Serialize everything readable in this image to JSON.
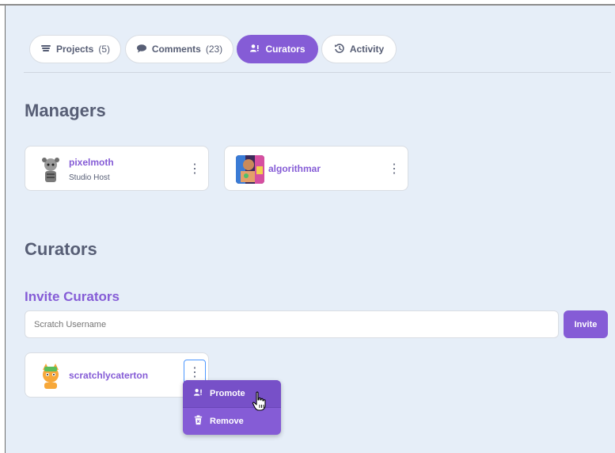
{
  "tabs": [
    {
      "label": "Projects",
      "count": "(5)",
      "icon": "projects-icon"
    },
    {
      "label": "Comments",
      "count": "(23)",
      "icon": "comment-icon"
    },
    {
      "label": "Curators",
      "count": "",
      "icon": "curators-icon",
      "active": true
    },
    {
      "label": "Activity",
      "count": "",
      "icon": "history-icon"
    }
  ],
  "managers": {
    "heading": "Managers",
    "items": [
      {
        "username": "pixelmoth",
        "role": "Studio Host"
      },
      {
        "username": "algorithmar",
        "role": ""
      }
    ]
  },
  "curators": {
    "heading": "Curators",
    "invite_heading": "Invite Curators",
    "input_placeholder": "Scratch Username",
    "invite_label": "Invite",
    "items": [
      {
        "username": "scratchlycaterton"
      }
    ]
  },
  "menu": {
    "promote_label": "Promote",
    "remove_label": "Remove"
  },
  "colors": {
    "accent": "#855cd6",
    "background": "#e6eef8",
    "text": "#575e75"
  }
}
